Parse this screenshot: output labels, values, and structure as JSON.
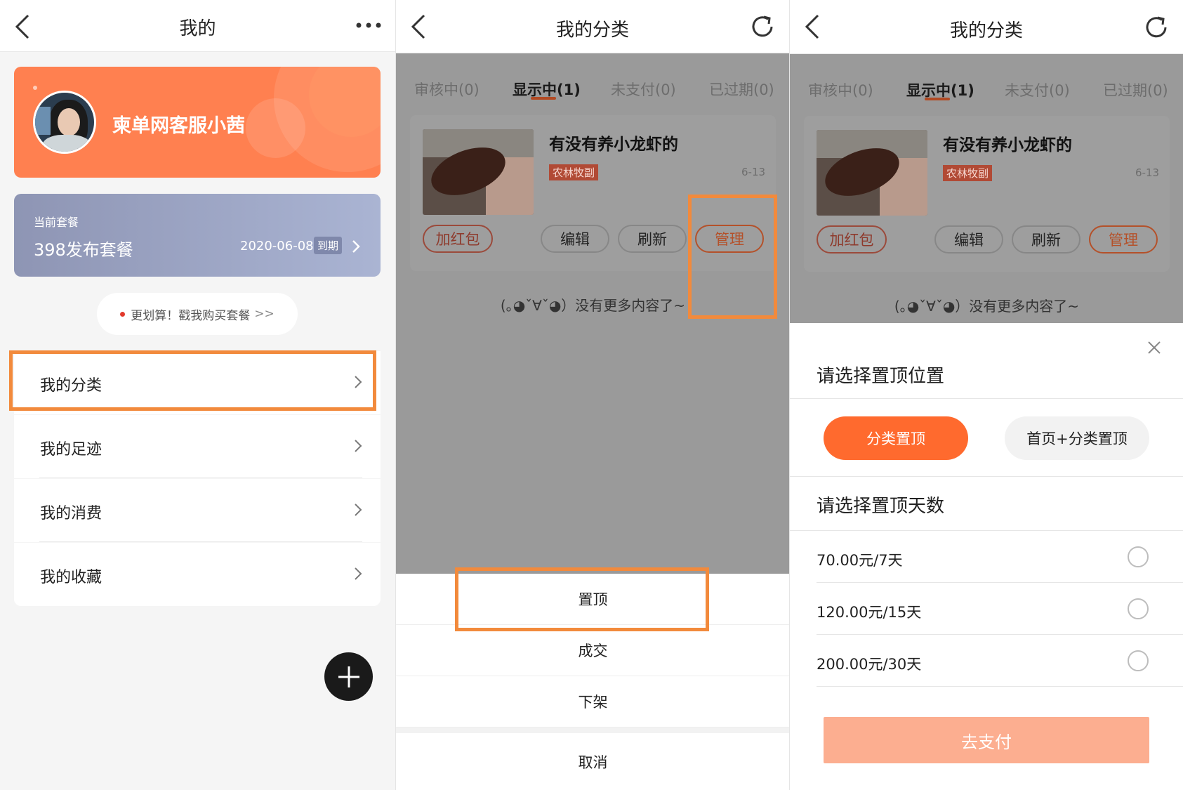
{
  "panel1": {
    "title": "我的",
    "profile": {
      "name": "柬单网客服小茜"
    },
    "package": {
      "label": "当前套餐",
      "name": "398发布套餐",
      "date": "2020-06-08",
      "badge": "到期"
    },
    "promo": "更划算！戳我购买套餐",
    "promo_arrow": ">>",
    "menu": [
      {
        "label": "我的分类"
      },
      {
        "label": "我的足迹"
      },
      {
        "label": "我的消费"
      },
      {
        "label": "我的收藏"
      }
    ],
    "fab_icon": "plus-icon"
  },
  "panel2": {
    "title": "我的分类",
    "tabs": [
      "审核中(0)",
      "显示中(1)",
      "未支付(0)",
      "已过期(0)"
    ],
    "active_tab": 1,
    "post": {
      "title": "有没有养小龙虾的",
      "tag": "农林牧副",
      "date": "6-13",
      "buttons": [
        "加红包",
        "编辑",
        "刷新",
        "管理"
      ]
    },
    "no_more": "(｡◕ˇ∀ˇ◕）没有更多内容了~",
    "sheet": [
      "置顶",
      "成交",
      "下架",
      "取消"
    ]
  },
  "panel3": {
    "title": "我的分类",
    "tabs": [
      "审核中(0)",
      "显示中(1)",
      "未支付(0)",
      "已过期(0)"
    ],
    "post": {
      "title": "有没有养小龙虾的",
      "tag": "农林牧副",
      "date": "6-13",
      "buttons": [
        "加红包",
        "编辑",
        "刷新",
        "管理"
      ]
    },
    "no_more": "(｡◕ˇ∀ˇ◕）没有更多内容了~",
    "modal": {
      "position_heading": "请选择置顶位置",
      "position_options": [
        "分类置顶",
        "首页+分类置顶"
      ],
      "days_heading": "请选择置顶天数",
      "prices": [
        "70.00元/7天",
        "120.00元/15天",
        "200.00元/30天"
      ],
      "pay_button": "去支付"
    }
  },
  "colors": {
    "accent": "#ff7b3e",
    "highlight_frame": "#f28a3c",
    "tag_red": "#e04a3a",
    "overlay": "#9a9a9a"
  }
}
